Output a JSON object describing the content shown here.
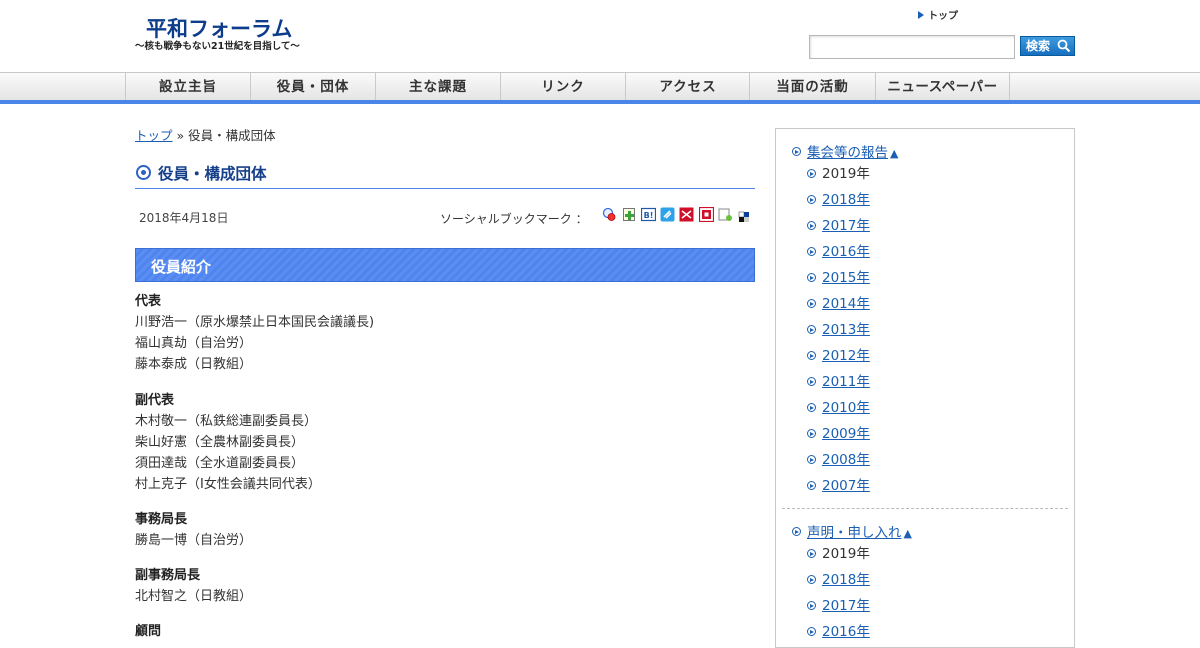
{
  "header": {
    "logo_title": "平和フォーラム",
    "logo_subtitle": "～核も戦争もない21世紀を目指して～",
    "top_link": "トップ",
    "search": {
      "value": "",
      "button_label": "検索"
    }
  },
  "nav": {
    "items": [
      {
        "label": "設立主旨"
      },
      {
        "label": "役員・団体"
      },
      {
        "label": "主な課題"
      },
      {
        "label": "リンク"
      },
      {
        "label": "アクセス"
      },
      {
        "label": "当面の活動"
      },
      {
        "label": "ニュースペーパー"
      }
    ]
  },
  "breadcrumb": {
    "home": "トップ",
    "separator": "»",
    "current": "役員・構成団体"
  },
  "page": {
    "title": "役員・構成団体",
    "date": "2018年4月18日",
    "social_label": "ソーシャルブックマーク ：",
    "social_icons": [
      "google-bookmark-icon",
      "add-clip-icon",
      "hatena-bookmark-icon",
      "livedoor-clip-icon",
      "buzzurl-icon",
      "nifty-clip-icon",
      "pookmark-icon",
      "delicious-icon"
    ],
    "section_title": "役員紹介"
  },
  "officers": [
    {
      "role": "代表",
      "members": [
        "川野浩一（原水爆禁止日本国民会議議長)",
        "福山真劫（自治労）",
        "藤本泰成（日教組）"
      ]
    },
    {
      "role": "副代表",
      "members": [
        "木村敬一（私鉄総連副委員長）",
        "柴山好憲（全農林副委員長）",
        "須田達哉（全水道副委員長）",
        "村上克子（I女性会議共同代表）"
      ]
    },
    {
      "role": "事務局長",
      "members": [
        "勝島一博（自治労）"
      ]
    },
    {
      "role": "副事務局長",
      "members": [
        "北村智之（日教組）"
      ]
    },
    {
      "role": "顧問",
      "members": []
    }
  ],
  "sidebar": {
    "categories": [
      {
        "label": "集会等の報告",
        "caret": "▲",
        "years": [
          "2019年",
          "2018年",
          "2017年",
          "2016年",
          "2015年",
          "2014年",
          "2013年",
          "2012年",
          "2011年",
          "2010年",
          "2009年",
          "2008年",
          "2007年"
        ],
        "current_year": "2019年"
      },
      {
        "label": "声明・申し入れ",
        "caret": "▲",
        "years": [
          "2019年",
          "2018年",
          "2017年",
          "2016年"
        ],
        "current_year": "2019年"
      }
    ]
  },
  "colors": {
    "accent": "#4a86e8",
    "logo": "#0d3c8c",
    "link": "#1a5fb4",
    "banner": "#5b8ef3"
  }
}
